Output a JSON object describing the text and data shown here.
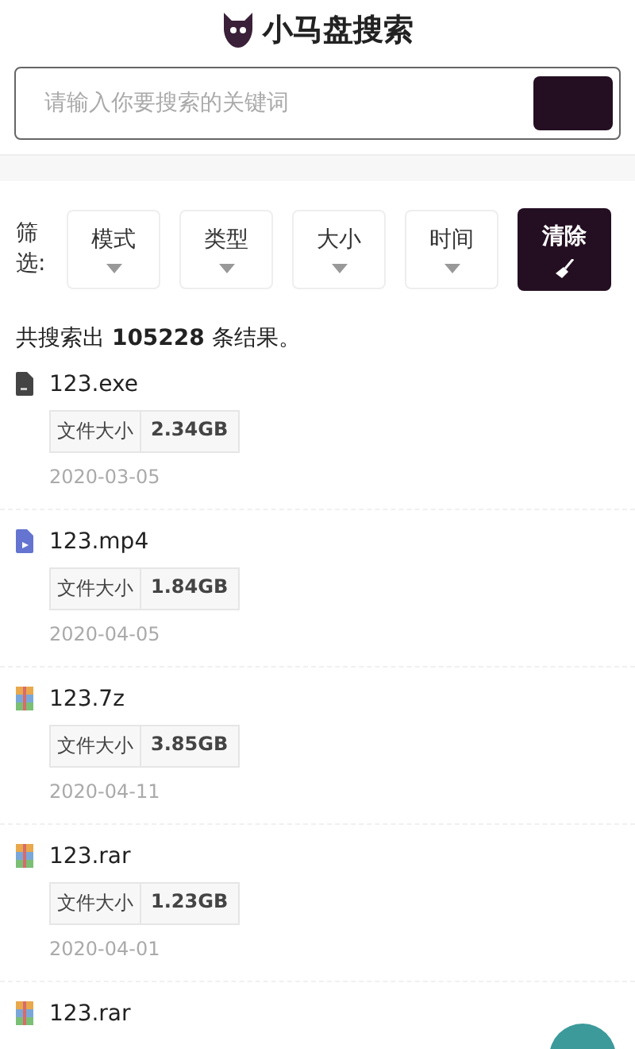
{
  "header": {
    "title": "小马盘搜索"
  },
  "search": {
    "placeholder": "请输入你要搜索的关键词"
  },
  "filters": {
    "label": "筛选:",
    "options": [
      "模式",
      "类型",
      "大小",
      "时间"
    ],
    "clear": "清除"
  },
  "summary": {
    "before": "共搜索出",
    "count": "105228",
    "after": "条结果。"
  },
  "results": [
    {
      "kind": "exe",
      "name": "123.exe",
      "size_label": "文件大小",
      "size": "2.34GB",
      "date": "2020-03-05"
    },
    {
      "kind": "video",
      "name": "123.mp4",
      "size_label": "文件大小",
      "size": "1.84GB",
      "date": "2020-04-05"
    },
    {
      "kind": "archive",
      "name": "123.7z",
      "size_label": "文件大小",
      "size": "3.85GB",
      "date": "2020-04-11"
    },
    {
      "kind": "archive",
      "name": "123.rar",
      "size_label": "文件大小",
      "size": "1.23GB",
      "date": "2020-04-01"
    },
    {
      "kind": "archive",
      "name": "123.rar"
    }
  ]
}
